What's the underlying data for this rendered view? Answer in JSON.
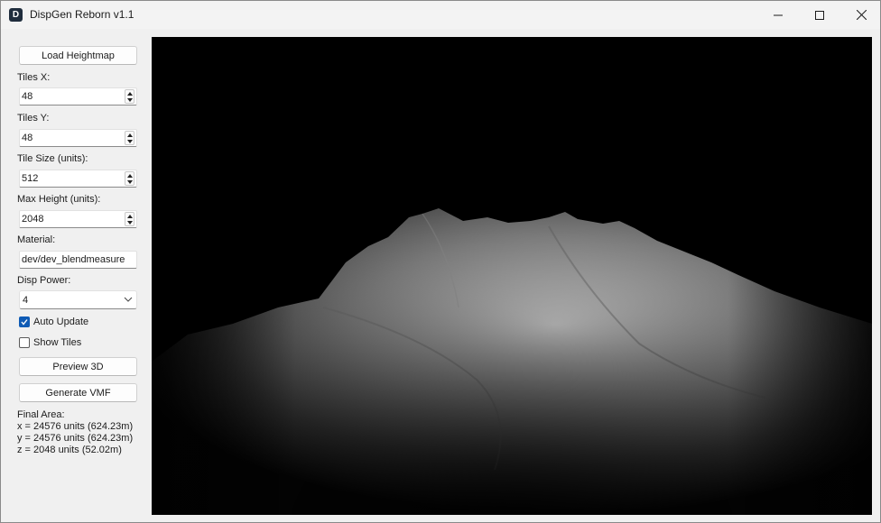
{
  "window": {
    "title": "DispGen Reborn v1.1",
    "icon": "D"
  },
  "sidebar": {
    "load_button": "Load Heightmap",
    "tiles_x": {
      "label": "Tiles X:",
      "value": "48"
    },
    "tiles_y": {
      "label": "Tiles Y:",
      "value": "48"
    },
    "tile_size": {
      "label": "Tile Size (units):",
      "value": "512"
    },
    "max_height": {
      "label": "Max Height (units):",
      "value": "2048"
    },
    "material": {
      "label": "Material:",
      "value": "dev/dev_blendmeasure"
    },
    "disp_power": {
      "label": "Disp Power:",
      "value": "4"
    },
    "auto_update": {
      "label": "Auto Update",
      "checked": true
    },
    "show_tiles": {
      "label": "Show Tiles",
      "checked": false
    },
    "preview_button": "Preview 3D",
    "generate_button": "Generate VMF",
    "final_area": {
      "heading": "Final Area:",
      "x": "x = 24576 units (624.23m)",
      "y": "y = 24576 units (624.23m)",
      "z": "z = 2048 units (52.02m)"
    }
  },
  "colors": {
    "accent": "#0f5bb5",
    "viewport_bg": "#000000"
  }
}
